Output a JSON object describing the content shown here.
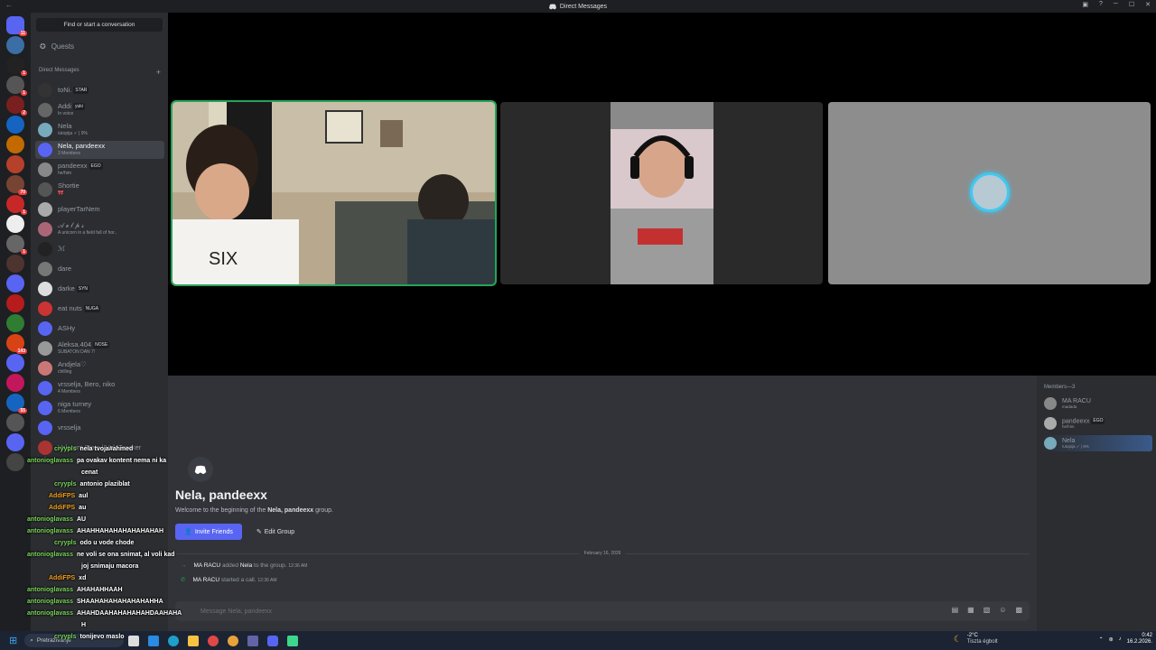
{
  "window": {
    "title": "Direct Messages",
    "back": "←",
    "controls": [
      "─",
      "☐",
      "✕"
    ]
  },
  "servers": [
    {
      "name": "home",
      "color": "#5865f2",
      "badge": "11"
    },
    {
      "name": "s1",
      "color": "#3a6ea5",
      "badge": ""
    },
    {
      "name": "s2",
      "color": "#222",
      "badge": "1"
    },
    {
      "name": "s3",
      "color": "#555",
      "badge": "1"
    },
    {
      "name": "s4",
      "color": "#7a1f1f",
      "badge": "2"
    },
    {
      "name": "s5",
      "color": "#1565c0",
      "badge": ""
    },
    {
      "name": "s6",
      "color": "#c26a00",
      "badge": ""
    },
    {
      "name": "s7",
      "color": "#b5412a",
      "badge": ""
    },
    {
      "name": "s8",
      "color": "#774433",
      "badge": "70"
    },
    {
      "name": "s9",
      "color": "#c62828",
      "badge": "1"
    },
    {
      "name": "s10",
      "color": "#eeeeee",
      "badge": ""
    },
    {
      "name": "s11",
      "color": "#666",
      "badge": "1"
    },
    {
      "name": "s12",
      "color": "#4e342e",
      "badge": ""
    },
    {
      "name": "s13",
      "color": "#5865f2",
      "badge": ""
    },
    {
      "name": "s14",
      "color": "#b71c1c",
      "badge": ""
    },
    {
      "name": "s15",
      "color": "#2e7d32",
      "badge": ""
    },
    {
      "name": "s16",
      "color": "#d84315",
      "badge": "143"
    },
    {
      "name": "s17",
      "color": "#5865f2",
      "badge": ""
    },
    {
      "name": "s18",
      "color": "#c2185b",
      "badge": ""
    },
    {
      "name": "s19",
      "color": "#1565c0",
      "badge": "55"
    },
    {
      "name": "s20",
      "color": "#555",
      "badge": ""
    },
    {
      "name": "s21",
      "color": "#5865f2",
      "badge": ""
    },
    {
      "name": "s22",
      "color": "#444",
      "badge": ""
    }
  ],
  "sidebar": {
    "find": "Find or start a conversation",
    "quests": "Quests",
    "dm_header": "Direct Messages",
    "add": "+",
    "dms": [
      {
        "name": "toNi.",
        "tag": "STAR",
        "sub": "",
        "color": "#333"
      },
      {
        "name": "Addi",
        "tag": "yuki",
        "sub": "In voice",
        "color": "#666"
      },
      {
        "name": "Nela",
        "tag": "",
        "sub": "/utopija ✓ | 9%",
        "color": "#7ab"
      },
      {
        "name": "Nela, pandeexx",
        "tag": "",
        "sub": "3 Members",
        "color": "#5865f2"
      },
      {
        "name": "pandeexx",
        "tag": "EGO",
        "sub": "he/him",
        "color": "#888"
      },
      {
        "name": "Shortie",
        "tag": "",
        "sub": "🎀",
        "color": "#555"
      },
      {
        "name": "playerTarNem",
        "tag": "",
        "sub": "",
        "color": "#aaa"
      },
      {
        "name": "𝒜 ℯ 𝓁 𝓅 𝓈",
        "tag": "",
        "sub": "A unicorn in a field full of hor..",
        "color": "#a67"
      },
      {
        "name": "ℳ",
        "tag": "",
        "sub": "",
        "color": "#222"
      },
      {
        "name": "dare",
        "tag": "",
        "sub": "",
        "color": "#777"
      },
      {
        "name": "darke",
        "tag": "SYN",
        "sub": "",
        "color": "#ddd"
      },
      {
        "name": "eat nuts",
        "tag": "NUGA",
        "sub": "",
        "color": "#c33"
      },
      {
        "name": "ASHy",
        "tag": "",
        "sub": "",
        "color": "#5865f2"
      },
      {
        "name": "Aleksa.404",
        "tag": "NOSE",
        "sub": "SUBATON DAN 7!",
        "color": "#999"
      },
      {
        "name": "Andjela♡",
        "tag": "",
        "sub": "chilling",
        "color": "#c77"
      },
      {
        "name": "vrsselja, Bero, niko",
        "tag": "",
        "sub": "4 Members",
        "color": "#5865f2"
      },
      {
        "name": "niga turney",
        "tag": "",
        "sub": "6 Members",
        "color": "#5865f2"
      },
      {
        "name": "vrsselja",
        "tag": "",
        "sub": "",
        "color": "#5865f2"
      },
      {
        "name": "Valorant Stats | ValoTracker",
        "tag": "",
        "sub": "",
        "color": "#a33"
      }
    ]
  },
  "call": {
    "tiles": [
      "tile-1",
      "tile-2",
      "tile-3"
    ]
  },
  "members": {
    "header": "Members—3",
    "list": [
      {
        "name": "MA RACU",
        "tag": "",
        "sub": "madada",
        "color": "#888"
      },
      {
        "name": "pandeexx",
        "tag": "EGO",
        "sub": "he/him",
        "color": "#aaa"
      },
      {
        "name": "Nela",
        "tag": "",
        "sub": "/utopija ✓ | 9%",
        "color": "#7ab"
      }
    ]
  },
  "chat": {
    "title": "Nela, pandeexx",
    "welcome_pre": "Welcome to the beginning of the ",
    "welcome_bold": "Nela, pandeexx",
    "welcome_post": " group.",
    "invite": "Invite Friends",
    "edit": "Edit Group",
    "date": "February 16, 2026",
    "sys1": {
      "user": "MA RACU",
      "action": "added",
      "target": "Nela",
      "rest": "to the group.",
      "time": "12:36 AM"
    },
    "sys2": {
      "user": "MA RACU",
      "action": "started a call.",
      "time": "12:36 AM"
    },
    "placeholder": "Message Nela, pandeexx"
  },
  "overlay": [
    {
      "user": "cryypls",
      "color": "#7ad65a",
      "msg": "nela tvoja#ahmed"
    },
    {
      "user": "antonioglavass",
      "color": "#7ad65a",
      "msg": "pa ovakav kontent nema ni ka"
    },
    {
      "user": "",
      "color": "#fff",
      "msg": "cenat"
    },
    {
      "user": "cryypls",
      "color": "#7ad65a",
      "msg": "antonio plaziblat"
    },
    {
      "user": "AddiFPS",
      "color": "#f0a020",
      "msg": "aul"
    },
    {
      "user": "AddiFPS",
      "color": "#f0a020",
      "msg": "au"
    },
    {
      "user": "antonioglavass",
      "color": "#7ad65a",
      "msg": "AU"
    },
    {
      "user": "antonioglavass",
      "color": "#7ad65a",
      "msg": "AHAHHAHAHAHAHAHAHAH"
    },
    {
      "user": "cryypls",
      "color": "#7ad65a",
      "msg": "odo u vode chode"
    },
    {
      "user": "antonioglavass",
      "color": "#7ad65a",
      "msg": "ne voli se ona snimat, al voli kad"
    },
    {
      "user": "",
      "color": "#fff",
      "msg": "joj snimaju macora"
    },
    {
      "user": "AddiFPS",
      "color": "#f0a020",
      "msg": "xd"
    },
    {
      "user": "antonioglavass",
      "color": "#7ad65a",
      "msg": "AHAHAHHAAH"
    },
    {
      "user": "antonioglavass",
      "color": "#7ad65a",
      "msg": "SHAAHAHAHAHAHAHAHHA"
    },
    {
      "user": "antonioglavass",
      "color": "#7ad65a",
      "msg": "AHAHDAAHAHAHAHAHDAAHAHA"
    },
    {
      "user": "",
      "color": "#fff",
      "msg": "H"
    },
    {
      "user": "cryypls",
      "color": "#7ad65a",
      "msg": "tonijevo maslo"
    }
  ],
  "taskbar": {
    "search": "Pretraživanje",
    "weather_temp": "-2°C",
    "weather_desc": "Tiszta égbolt",
    "time": "0:42",
    "date": "16.2.2026."
  }
}
